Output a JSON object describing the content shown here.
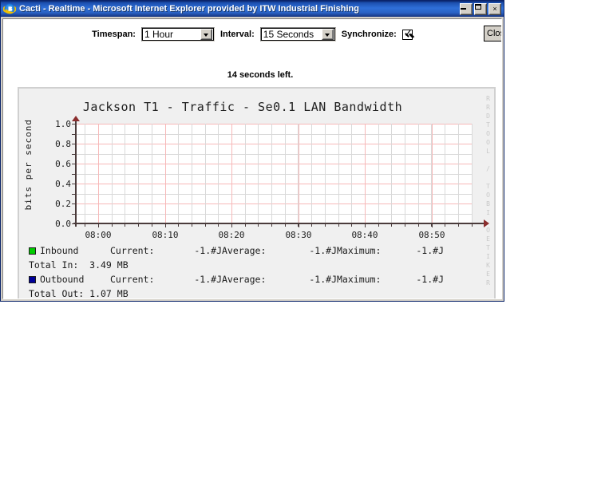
{
  "window": {
    "title": "Cacti - Realtime - Microsoft Internet Explorer provided by ITW Industrial Finishing",
    "app_icon": "internet-explorer-icon",
    "minimize_label": "",
    "maximize_label": "",
    "close_label": "×",
    "titlebar_color": "#0a246a"
  },
  "controls": {
    "timespan_label": "Timespan:",
    "timespan_value": "1 Hour",
    "interval_label": "Interval:",
    "interval_value": "15 Seconds",
    "synchronize_label": "Synchronize:",
    "synchronize_checked": true,
    "close_button_label": "Close",
    "countdown": "14 seconds left."
  },
  "graph": {
    "watermark": "RRDTOOL / TOBI OETIKER",
    "legend": {
      "rows": [
        {
          "name": "Inbound",
          "color": "#00cc00",
          "current_key": "Current:",
          "current_value": "-1.#J",
          "average_key": "Average:",
          "average_value": "-1.#J",
          "maximum_key": "Maximum:",
          "maximum_value": "-1.#J",
          "total": "Total In:  3.49 MB"
        },
        {
          "name": "Outbound",
          "color": "#000099",
          "current_key": "Current:",
          "current_value": "-1.#J",
          "average_key": "Average:",
          "average_value": "-1.#J",
          "maximum_key": "Maximum:",
          "maximum_value": "-1.#J",
          "total": "Total Out: 1.07 MB"
        }
      ]
    }
  },
  "chart_data": {
    "type": "line",
    "title": "Jackson T1 - Traffic - Se0.1 LAN Bandwidth",
    "xlabel": "",
    "ylabel": "bits per second",
    "ylim": [
      0.0,
      1.0
    ],
    "yticks": [
      "1.0",
      "0.8",
      "0.6",
      "0.4",
      "0.2",
      "0.0"
    ],
    "ytick_values": [
      1.0,
      0.8,
      0.6,
      0.4,
      0.2,
      0.0
    ],
    "xticks": [
      "08:00",
      "08:10",
      "08:20",
      "08:30",
      "08:40",
      "08:50"
    ],
    "grid": true,
    "grid_minor_color": "#d9d9d9",
    "grid_major_color": "#f7b9b9",
    "plot_background": "#ffffff",
    "legend_position": "below",
    "series": [
      {
        "name": "Inbound",
        "color": "#00cc00",
        "values": []
      },
      {
        "name": "Outbound",
        "color": "#000099",
        "values": []
      }
    ],
    "note": "no data plotted; empty plot area"
  }
}
